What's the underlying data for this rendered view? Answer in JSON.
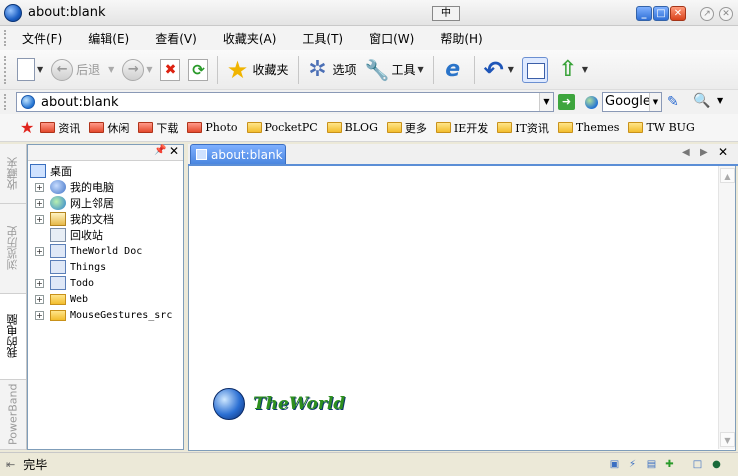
{
  "window": {
    "title": "about:blank",
    "ime_label": "中"
  },
  "menu": {
    "items": [
      {
        "label": "文件(F)"
      },
      {
        "label": "编辑(E)"
      },
      {
        "label": "查看(V)"
      },
      {
        "label": "收藏夹(A)"
      },
      {
        "label": "工具(T)"
      },
      {
        "label": "窗口(W)"
      },
      {
        "label": "帮助(H)"
      }
    ]
  },
  "toolbar": {
    "back_label": "后退",
    "favorites_label": "收藏夹",
    "options_label": "选项",
    "tools_label": "工具"
  },
  "address": {
    "url": "about:blank",
    "search_engine": "Google"
  },
  "favbar": {
    "items": [
      {
        "label": "资讯",
        "style": "red"
      },
      {
        "label": "休闲",
        "style": "red"
      },
      {
        "label": "下载",
        "style": "red"
      },
      {
        "label": "Photo",
        "style": "red"
      },
      {
        "label": "PocketPC",
        "style": "yellow"
      },
      {
        "label": "BLOG",
        "style": "yellow"
      },
      {
        "label": "更多",
        "style": "yellow"
      },
      {
        "label": "IE开发",
        "style": "yellow"
      },
      {
        "label": "IT资讯",
        "style": "yellow"
      },
      {
        "label": "Themes",
        "style": "yellow"
      },
      {
        "label": "TW BUG",
        "style": "yellow"
      }
    ]
  },
  "sidebar": {
    "tabs": [
      {
        "label": "收藏夹"
      },
      {
        "label": "浏览历史"
      },
      {
        "label": "我的电脑"
      },
      {
        "label": "PowerBand"
      }
    ],
    "tree": [
      {
        "label": "桌面",
        "icon": "desktop-icon",
        "expandable": false,
        "level": 0
      },
      {
        "label": "我的电脑",
        "icon": "computer-icon",
        "expandable": true,
        "level": 1
      },
      {
        "label": "网上邻居",
        "icon": "network-icon",
        "expandable": true,
        "level": 1
      },
      {
        "label": "我的文档",
        "icon": "documents-icon",
        "expandable": true,
        "level": 1
      },
      {
        "label": "回收站",
        "icon": "recycle-bin-icon",
        "expandable": false,
        "level": 1
      },
      {
        "label": "TheWorld Doc",
        "icon": "app-icon",
        "expandable": true,
        "level": 1
      },
      {
        "label": "Things",
        "icon": "app-icon",
        "expandable": false,
        "level": 1
      },
      {
        "label": "Todo",
        "icon": "app-icon",
        "expandable": true,
        "level": 1
      },
      {
        "label": "Web",
        "icon": "folder-icon",
        "expandable": true,
        "level": 1
      },
      {
        "label": "MouseGestures_src",
        "icon": "folder-icon",
        "expandable": true,
        "level": 1
      }
    ]
  },
  "tabs": [
    {
      "label": "about:blank"
    }
  ],
  "content": {
    "logo_text": "TheWorld"
  },
  "status": {
    "text": "完毕"
  }
}
